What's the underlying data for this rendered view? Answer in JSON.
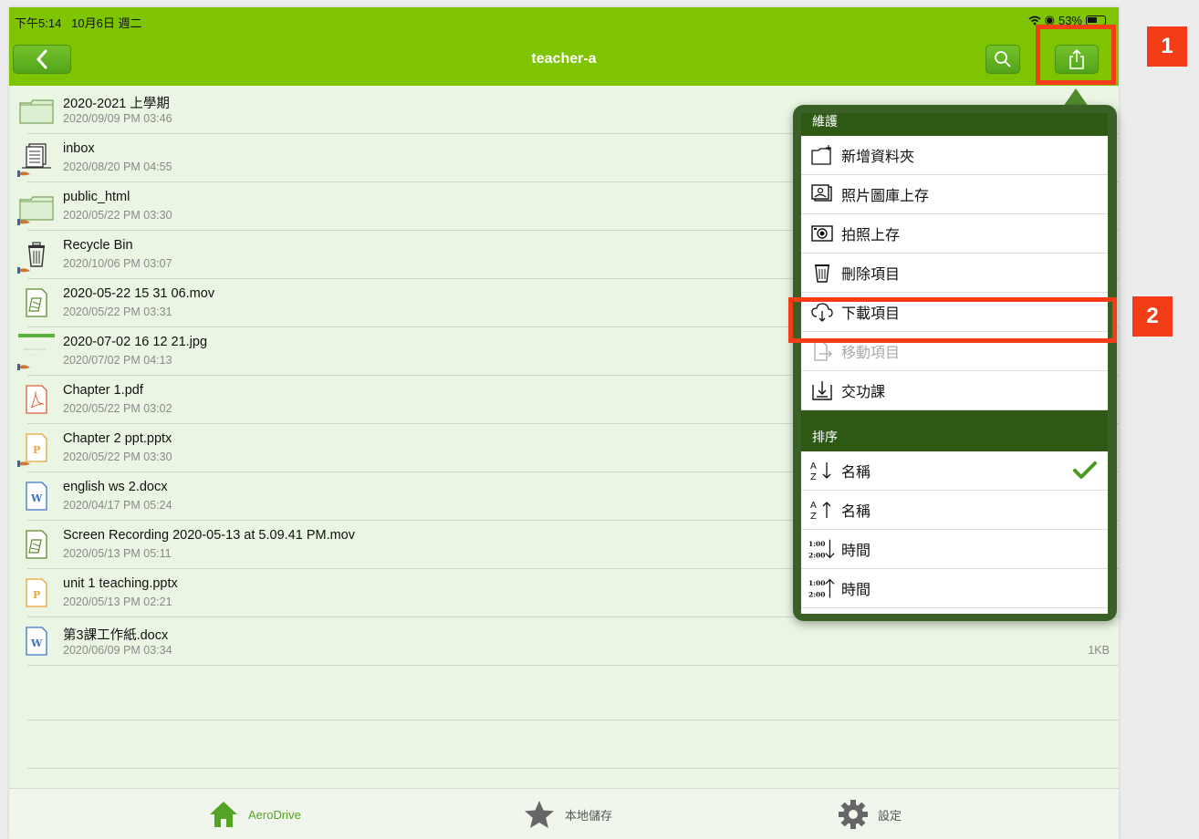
{
  "status_bar": {
    "time": "下午5:14",
    "date": "10月6日 週二",
    "battery": "53%"
  },
  "nav": {
    "title": "teacher-a"
  },
  "files": [
    {
      "name": "2020-2021 上學期",
      "date": "2020/09/09 PM 03:46",
      "icon": "folder-icon",
      "shared": false,
      "size": ""
    },
    {
      "name": "inbox",
      "date": "2020/08/20 PM 04:55",
      "icon": "inbox-icon",
      "shared": true,
      "size": ""
    },
    {
      "name": "public_html",
      "date": "2020/05/22 PM 03:30",
      "icon": "folder-icon",
      "shared": true,
      "size": ""
    },
    {
      "name": "Recycle Bin",
      "date": "2020/10/06 PM 03:07",
      "icon": "trash-icon",
      "shared": true,
      "size": ""
    },
    {
      "name": "2020-05-22 15 31 06.mov",
      "date": "2020/05/22 PM 03:31",
      "icon": "video-file-icon",
      "shared": false,
      "size": ""
    },
    {
      "name": "2020-07-02 16 12 21.jpg",
      "date": "2020/07/02 PM 04:13",
      "icon": "image-thumbnail-icon",
      "shared": true,
      "size": ""
    },
    {
      "name": "Chapter 1.pdf",
      "date": "2020/05/22 PM 03:02",
      "icon": "pdf-file-icon",
      "shared": false,
      "size": ""
    },
    {
      "name": "Chapter 2 ppt.pptx",
      "date": "2020/05/22 PM 03:30",
      "icon": "ppt-file-icon",
      "shared": true,
      "size": ""
    },
    {
      "name": "english ws 2.docx",
      "date": "2020/04/17 PM 05:24",
      "icon": "word-file-icon",
      "shared": false,
      "size": ""
    },
    {
      "name": "Screen Recording 2020-05-13 at 5.09.41 PM.mov",
      "date": "2020/05/13 PM 05:11",
      "icon": "video-file-icon",
      "shared": false,
      "size": ""
    },
    {
      "name": "unit 1 teaching.pptx",
      "date": "2020/05/13 PM 02:21",
      "icon": "ppt-file-icon",
      "shared": false,
      "size": ""
    },
    {
      "name": "第3課工作紙.docx",
      "date": "2020/06/09 PM 03:34",
      "icon": "word-file-icon",
      "shared": false,
      "size": "1KB"
    }
  ],
  "popover": {
    "maintenance_header": "維護",
    "maintenance_items": [
      {
        "label": "新增資料夾",
        "icon": "new-folder-icon",
        "disabled": false
      },
      {
        "label": "照片圖庫上存",
        "icon": "photo-library-icon",
        "disabled": false
      },
      {
        "label": "拍照上存",
        "icon": "camera-icon",
        "disabled": false
      },
      {
        "label": "刪除項目",
        "icon": "trash-icon",
        "disabled": false
      },
      {
        "label": "下載項目",
        "icon": "cloud-download-icon",
        "disabled": false
      },
      {
        "label": "移動項目",
        "icon": "move-icon",
        "disabled": true
      },
      {
        "label": "交功課",
        "icon": "submit-homework-icon",
        "disabled": false
      }
    ],
    "sort_header": "排序",
    "sort_items": [
      {
        "label": "名稱",
        "icon": "sort-az-down-icon",
        "checked": true
      },
      {
        "label": "名稱",
        "icon": "sort-az-up-icon",
        "checked": false
      },
      {
        "label": "時間",
        "icon": "sort-time-down-icon",
        "checked": false
      },
      {
        "label": "時間",
        "icon": "sort-time-up-icon",
        "checked": false
      }
    ]
  },
  "tabs": [
    {
      "label": "AeroDrive",
      "icon": "home-icon",
      "active": true
    },
    {
      "label": "本地儲存",
      "icon": "star-icon",
      "active": false
    },
    {
      "label": "設定",
      "icon": "gear-icon",
      "active": false
    }
  ],
  "callouts": [
    "1",
    "2"
  ],
  "colors": {
    "nav_green": "#7ec400",
    "popover_dark": "#2f5a16",
    "callout_red": "#f33d17",
    "list_bg": "#eaf5e3"
  }
}
